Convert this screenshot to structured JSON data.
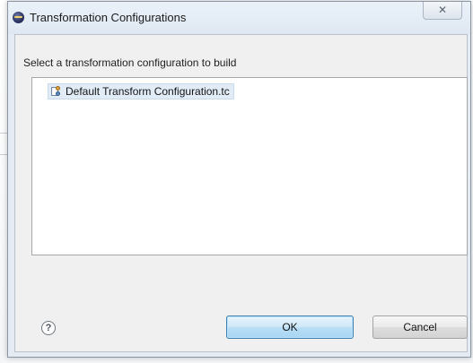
{
  "dialog": {
    "title": "Transformation Configurations",
    "close_glyph": "✕",
    "instruction": "Select a transformation configuration to build",
    "items": [
      {
        "label": "Default Transform Configuration.tc",
        "icon": "transform-config-file-icon",
        "selected": true
      }
    ],
    "help_glyph": "?",
    "ok_label": "OK",
    "cancel_label": "Cancel"
  },
  "colors": {
    "title_bar": "#e4ebf3",
    "client_background": "#f0f0f0",
    "ok_button_border": "#3c7fb1",
    "selected_item_background": "#e1ecf7"
  }
}
